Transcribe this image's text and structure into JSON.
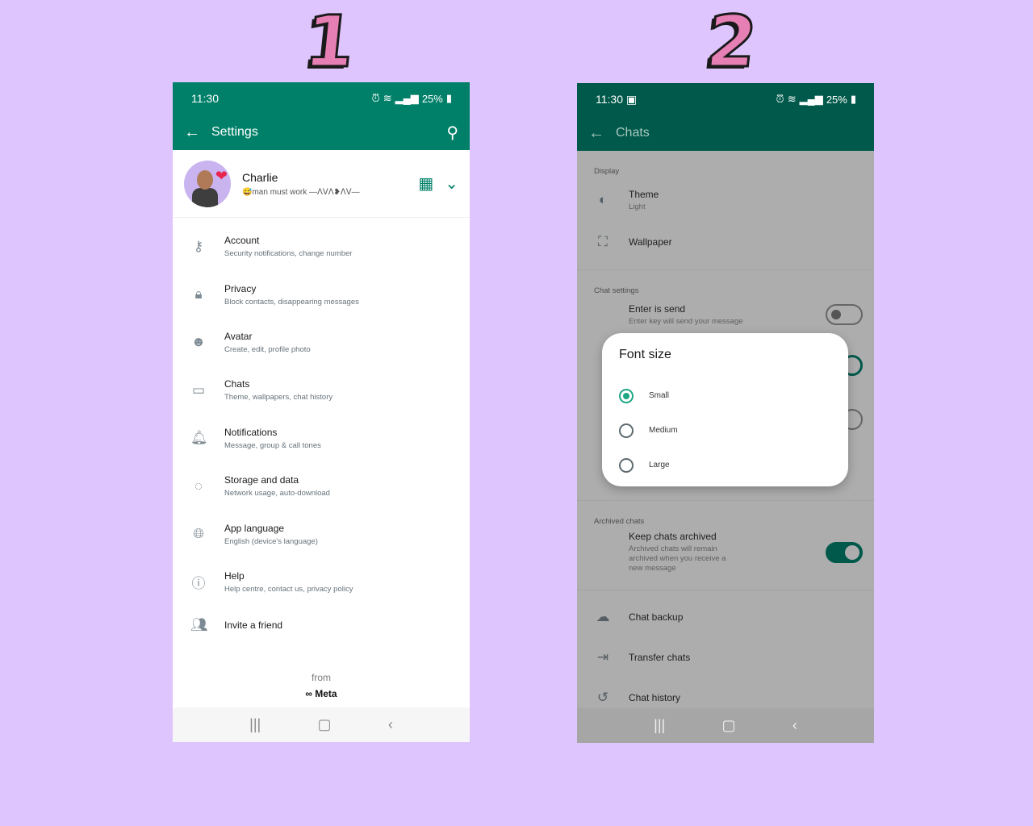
{
  "step_labels": [
    "1",
    "2"
  ],
  "screen1": {
    "status": {
      "time": "11:30",
      "battery": "25%"
    },
    "appbar": {
      "title": "Settings"
    },
    "profile": {
      "name": "Charlie",
      "about": "😅man must work —ᐱᐯᐱ❥ᐱᐯ—"
    },
    "menu": [
      {
        "icon": "key-icon",
        "glyph": "⚷",
        "title": "Account",
        "subtitle": "Security notifications, change number"
      },
      {
        "icon": "lock-icon",
        "glyph": "🔒︎",
        "title": "Privacy",
        "subtitle": "Block contacts, disappearing messages"
      },
      {
        "icon": "avatar-icon",
        "glyph": "☻",
        "title": "Avatar",
        "subtitle": "Create, edit, profile photo"
      },
      {
        "icon": "chat-icon",
        "glyph": "▭",
        "title": "Chats",
        "subtitle": "Theme, wallpapers, chat history"
      },
      {
        "icon": "bell-icon",
        "glyph": "🔔︎",
        "title": "Notifications",
        "subtitle": "Message, group & call tones"
      },
      {
        "icon": "storage-icon",
        "glyph": "◌",
        "title": "Storage and data",
        "subtitle": "Network usage, auto-download"
      },
      {
        "icon": "globe-icon",
        "glyph": "🌐︎",
        "title": "App language",
        "subtitle": "English (device's language)"
      },
      {
        "icon": "help-icon",
        "glyph": "ⓘ",
        "title": "Help",
        "subtitle": "Help centre, contact us, privacy policy"
      },
      {
        "icon": "people-icon",
        "glyph": "👥︎",
        "title": "Invite a friend",
        "subtitle": ""
      }
    ],
    "footer": {
      "from": "from",
      "brand": "∞ Meta"
    }
  },
  "screen2": {
    "status": {
      "time": "11:30",
      "battery": "25%"
    },
    "appbar": {
      "title": "Chats"
    },
    "display_section": {
      "title": "Display",
      "theme": {
        "title": "Theme",
        "value": "Light"
      },
      "wallpaper": {
        "title": "Wallpaper"
      }
    },
    "chat_settings_section": {
      "title": "Chat settings",
      "enter_is_send": {
        "title": "Enter is send",
        "subtitle": "Enter key will send your message",
        "enabled": false
      }
    },
    "archived_section": {
      "title": "Archived chats",
      "keep_archived": {
        "title": "Keep chats archived",
        "subtitle": "Archived chats will remain archived when you receive a new message",
        "enabled": true
      }
    },
    "other_items": [
      {
        "icon": "cloud-upload-icon",
        "glyph": "☁",
        "title": "Chat backup"
      },
      {
        "icon": "transfer-icon",
        "glyph": "⇥",
        "title": "Transfer chats"
      },
      {
        "icon": "history-icon",
        "glyph": "↺",
        "title": "Chat history"
      }
    ],
    "font_size_dialog": {
      "title": "Font size",
      "options": [
        "Small",
        "Medium",
        "Large"
      ],
      "selected": "Small"
    }
  }
}
